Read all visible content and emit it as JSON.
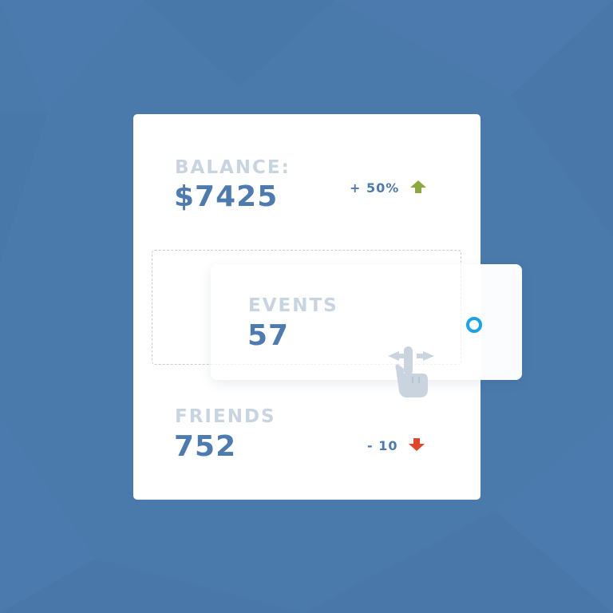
{
  "colors": {
    "background": "#4a79ac",
    "card": "#ffffff",
    "label": "#c9d4e1",
    "value": "#4d7bb0",
    "trend_up": "#8aaa3e",
    "trend_down": "#e2462a",
    "handle": "#1aa3e8"
  },
  "stats": {
    "balance": {
      "label": "BALANCE:",
      "value": "$7425",
      "change": "+ 50%",
      "trend_icon": "arrow-up-icon"
    },
    "events": {
      "label": "EVENTS",
      "value": "57"
    },
    "friends": {
      "label": "FRIENDS",
      "value": "752",
      "change": "- 10",
      "trend_icon": "arrow-down-icon"
    }
  },
  "icons": {
    "drag_hand": "drag-hand-icon",
    "handle": "drag-handle-icon"
  }
}
